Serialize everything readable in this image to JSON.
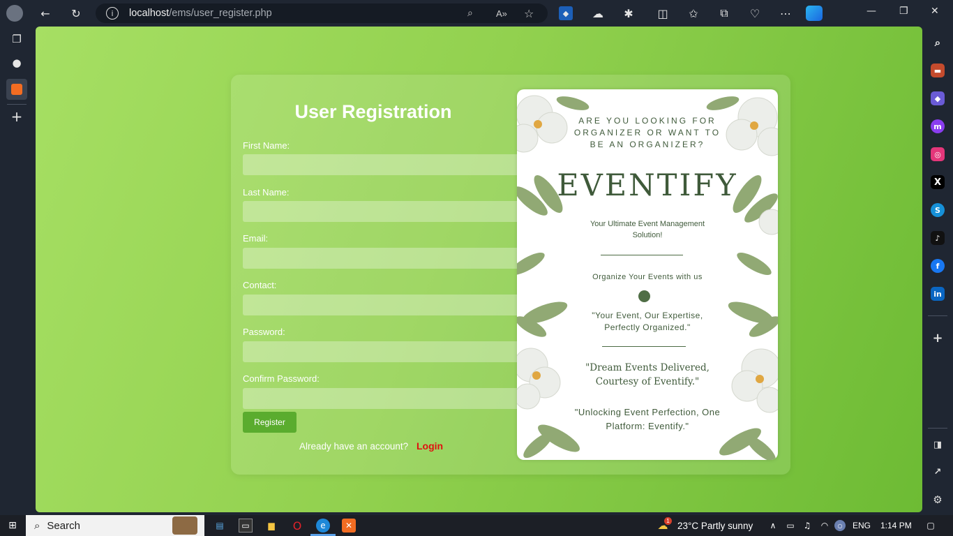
{
  "browser": {
    "url_host": "localhost",
    "url_path": "/ems/user_register.php"
  },
  "form": {
    "title": "User Registration",
    "fields": [
      {
        "label": "First Name:"
      },
      {
        "label": "Last Name:"
      },
      {
        "label": "Email:"
      },
      {
        "label": "Contact:"
      },
      {
        "label": "Password:"
      },
      {
        "label": "Confirm Password:"
      }
    ],
    "register_label": "Register",
    "already_text": "Already have an account?",
    "login_label": "Login"
  },
  "poster": {
    "question": "ARE YOU LOOKING FOR ORGANIZER OR WANT TO BE AN ORGANIZER?",
    "brand": "EVENTIFY",
    "tagline": "Your Ultimate Event Management Solution!",
    "organize": "Organize Your Events with us",
    "quote1": "\"Your Event, Our Expertise, Perfectly Organized.\"",
    "quote2": "\"Dream Events Delivered, Courtesy of Eventify.\"",
    "quote3": "\"Unlocking Event Perfection, One Platform: Eventify.\""
  },
  "taskbar": {
    "search_label": "Search",
    "weather": "23°C  Partly sunny",
    "language": "ENG",
    "time": "1:14 PM",
    "weather_badge": "1"
  },
  "colors": {
    "accent_green": "#5aac2e",
    "login_red": "#e01010",
    "background_green": "#92d14f"
  }
}
